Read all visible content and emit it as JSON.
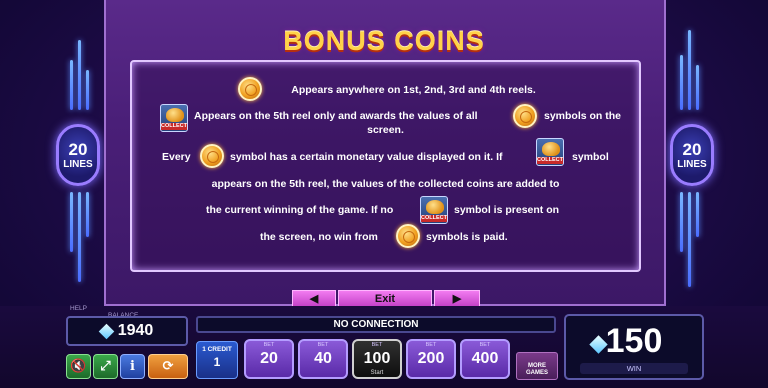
{
  "title": "BONUS COINS",
  "lines_badge": {
    "value": "20",
    "label": "LINES"
  },
  "rules": {
    "line1": "Appears anywhere on 1st, 2nd, 3rd and 4th reels.",
    "line2a": "Appears on the 5th reel only and awards the values of all",
    "line2b": "symbols on the",
    "line2c": "screen.",
    "line3a": "Every",
    "line3b": "symbol has a certain monetary value displayed on it. If",
    "line3c": "symbol",
    "line4": "appears on the 5th reel, the values of the collected coins are added to",
    "line5a": "the current winning of the game. If no",
    "line5b": "symbol is present on",
    "line6a": "the screen, no win from",
    "line6b": "symbols is paid.",
    "collect_word": "COLLECT"
  },
  "nav": {
    "prev": "◀",
    "exit": "Exit",
    "next": "▶"
  },
  "help_label": "HELP",
  "balance": {
    "label": "BALANCE",
    "value": "1940"
  },
  "status": "NO CONNECTION",
  "win": {
    "value": "150",
    "label": "WIN"
  },
  "credit": {
    "label": "1 CREDIT",
    "value": "1"
  },
  "bets": [
    {
      "caption": "BET",
      "value": "20",
      "sub": ""
    },
    {
      "caption": "BET",
      "value": "40",
      "sub": ""
    },
    {
      "caption": "BET",
      "value": "100",
      "sub": "Start"
    },
    {
      "caption": "BET",
      "value": "200",
      "sub": ""
    },
    {
      "caption": "BET",
      "value": "400",
      "sub": ""
    }
  ],
  "more_games": {
    "line1": "MORE",
    "line2": "GAMES"
  },
  "controls": {
    "sound_icon": "speaker-mute-icon",
    "fullscreen_icon": "fullscreen-icon",
    "info_icon": "info-icon",
    "autoplay_icon": "autoplay-icon"
  },
  "colors": {
    "title": "#ffd24a",
    "bet_active": "#111111",
    "panel": "#4a1f78"
  }
}
